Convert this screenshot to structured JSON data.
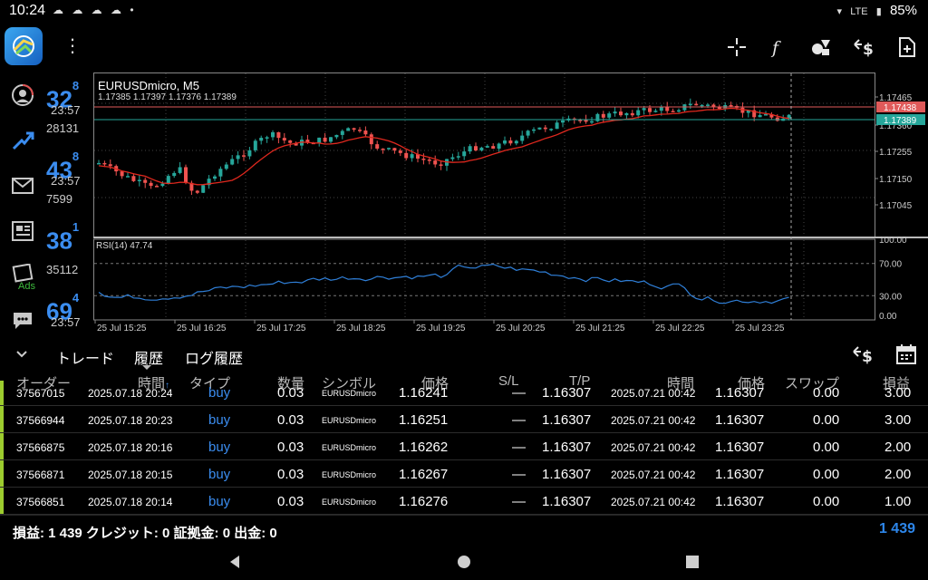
{
  "status": {
    "time": "10:24",
    "notification_icons": "☁ ☁ ☁ ☁ •",
    "network": "LTE",
    "battery": "85%"
  },
  "quotes": [
    {
      "big": "32",
      "sup": "8",
      "time": "23:57",
      "num": "28131"
    },
    {
      "big": "43",
      "sup": "8",
      "time": "23:57",
      "num": "7599"
    },
    {
      "big": "38",
      "sup": "1",
      "time": "",
      "num": "35112"
    },
    {
      "big": "69",
      "sup": "4",
      "time": "23:57",
      "num": ""
    }
  ],
  "nav": {
    "ads_label": "Ads"
  },
  "chart": {
    "title": "EURUSDmicro, M5",
    "ohlc": "1.17385 1.17397 1.17376 1.17389",
    "price_labels": [
      "1.17465",
      "1.17360",
      "1.17255",
      "1.17150",
      "1.17045"
    ],
    "ask_price": "1.17438",
    "bid_price": "1.17389",
    "rsi_label": "RSI(14) 47.74",
    "rsi_levels": [
      "100.00",
      "70.00",
      "30.00",
      "0.00"
    ],
    "time_labels": [
      "25 Jul 15:25",
      "25 Jul 16:25",
      "25 Jul 17:25",
      "25 Jul 18:25",
      "25 Jul 19:25",
      "25 Jul 20:25",
      "25 Jul 21:25",
      "25 Jul 22:25",
      "25 Jul 23:25"
    ],
    "colors": {
      "bull": "#26a69a",
      "bear": "#ef5350",
      "ma": "#e0281e",
      "rsi": "#2f7fd8",
      "ask": "#e05a5a",
      "bid": "#26a69a"
    }
  },
  "tabs": {
    "trade": "トレード",
    "history": "履歴",
    "log": "ログ履歴"
  },
  "table": {
    "headers": {
      "order": "オーダー",
      "time": "時間",
      "sort_arrow": "↑",
      "type": "タイプ",
      "volume": "数量",
      "symbol": "シンボル",
      "price": "価格",
      "sl": "S/L",
      "tp": "T/P",
      "close_time": "時間",
      "close_price": "価格",
      "swap": "スワップ",
      "profit": "損益"
    },
    "rows": [
      {
        "order": "37567015",
        "time": "2025.07.18 20:24",
        "type": "buy",
        "volume": "0.03",
        "symbol": "EURUSDmicro",
        "price": "1.16241",
        "sl": "—",
        "tp": "1.16307",
        "close_time": "2025.07.21 00:42",
        "close_price": "1.16307",
        "swap": "0.00",
        "profit": "3.00"
      },
      {
        "order": "37566944",
        "time": "2025.07.18 20:23",
        "type": "buy",
        "volume": "0.03",
        "symbol": "EURUSDmicro",
        "price": "1.16251",
        "sl": "—",
        "tp": "1.16307",
        "close_time": "2025.07.21 00:42",
        "close_price": "1.16307",
        "swap": "0.00",
        "profit": "3.00"
      },
      {
        "order": "37566875",
        "time": "2025.07.18 20:16",
        "type": "buy",
        "volume": "0.03",
        "symbol": "EURUSDmicro",
        "price": "1.16262",
        "sl": "—",
        "tp": "1.16307",
        "close_time": "2025.07.21 00:42",
        "close_price": "1.16307",
        "swap": "0.00",
        "profit": "2.00"
      },
      {
        "order": "37566871",
        "time": "2025.07.18 20:15",
        "type": "buy",
        "volume": "0.03",
        "symbol": "EURUSDmicro",
        "price": "1.16267",
        "sl": "—",
        "tp": "1.16307",
        "close_time": "2025.07.21 00:42",
        "close_price": "1.16307",
        "swap": "0.00",
        "profit": "2.00"
      },
      {
        "order": "37566851",
        "time": "2025.07.18 20:14",
        "type": "buy",
        "volume": "0.03",
        "symbol": "EURUSDmicro",
        "price": "1.16276",
        "sl": "—",
        "tp": "1.16307",
        "close_time": "2025.07.21 00:42",
        "close_price": "1.16307",
        "swap": "0.00",
        "profit": "1.00"
      }
    ]
  },
  "totals": {
    "summary": "損益: 1 439  クレジット: 0  証拠金: 0  出金: 0",
    "total": "1 439"
  }
}
